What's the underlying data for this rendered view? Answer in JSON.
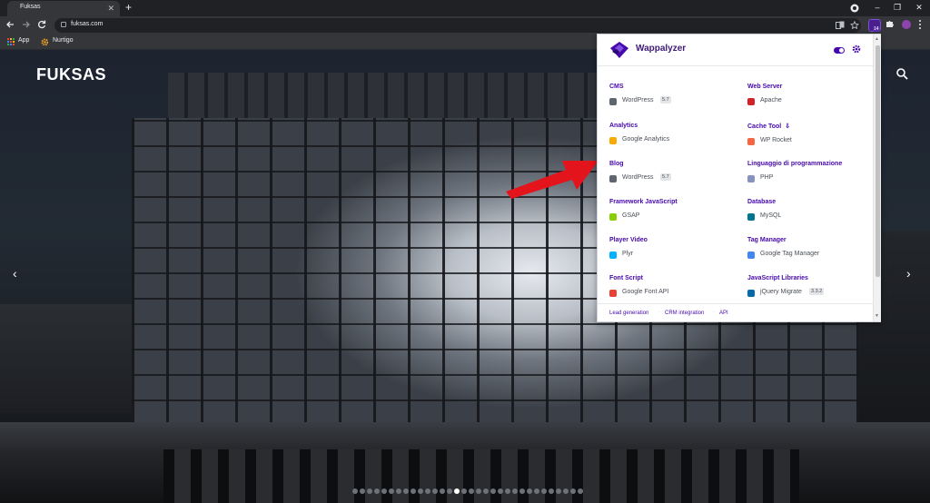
{
  "browser": {
    "tab_title": "Fuksas",
    "tab_close": "✕",
    "new_tab": "+",
    "window_controls": [
      "–",
      "❐",
      "✕"
    ],
    "url": "fuksas.com",
    "nav_icons": [
      "back-icon",
      "forward-icon",
      "reload-icon"
    ],
    "extension_badge": "14",
    "bookmarks": [
      {
        "label": "App",
        "icon": "apps-grid-icon"
      },
      {
        "label": "Nurtigo",
        "icon": "gear-orange-icon"
      }
    ]
  },
  "site": {
    "logo": "FUKSAS",
    "prev_arrow": "‹",
    "next_arrow": "›",
    "slide_count": 32,
    "active_slide": 14
  },
  "wappalyzer": {
    "title": "Wappalyzer",
    "toggle_on": true,
    "accent_color": "#4608ad",
    "categories_left": [
      {
        "name": "CMS",
        "techs": [
          {
            "name": "WordPress",
            "version": "5.7",
            "icon": "wordpress-icon",
            "color": "#5f6670"
          }
        ]
      },
      {
        "name": "Analytics",
        "techs": [
          {
            "name": "Google Analytics",
            "version": "",
            "icon": "google-analytics-icon",
            "color": "#f9ab00"
          }
        ]
      },
      {
        "name": "Blog",
        "techs": [
          {
            "name": "WordPress",
            "version": "5.7",
            "icon": "wordpress-icon",
            "color": "#5f6670"
          }
        ]
      },
      {
        "name": "Framework JavaScript",
        "techs": [
          {
            "name": "GSAP",
            "version": "",
            "icon": "gsap-icon",
            "color": "#88ce02"
          }
        ]
      },
      {
        "name": "Player Video",
        "techs": [
          {
            "name": "Plyr",
            "version": "",
            "icon": "plyr-icon",
            "color": "#00b3ff"
          }
        ]
      },
      {
        "name": "Font Script",
        "techs": [
          {
            "name": "Google Font API",
            "version": "",
            "icon": "google-font-icon",
            "color": "#e94235"
          }
        ]
      }
    ],
    "categories_right": [
      {
        "name": "Web Server",
        "pin": "",
        "techs": [
          {
            "name": "Apache",
            "version": "",
            "icon": "apache-feather-icon",
            "color": "#d22128"
          }
        ]
      },
      {
        "name": "Cache Tool",
        "pin": "⇩",
        "techs": [
          {
            "name": "WP Rocket",
            "version": "",
            "icon": "wp-rocket-icon",
            "color": "#f56640"
          }
        ]
      },
      {
        "name": "Linguaggio di programmazione",
        "pin": "",
        "techs": [
          {
            "name": "PHP",
            "version": "",
            "icon": "php-icon",
            "color": "#8892bf"
          }
        ]
      },
      {
        "name": "Database",
        "pin": "",
        "techs": [
          {
            "name": "MySQL",
            "version": "",
            "icon": "mysql-icon",
            "color": "#00758f"
          }
        ]
      },
      {
        "name": "Tag Manager",
        "pin": "",
        "techs": [
          {
            "name": "Google Tag Manager",
            "version": "",
            "icon": "google-tag-manager-icon",
            "color": "#4285f4"
          }
        ]
      },
      {
        "name": "JavaScript Libraries",
        "pin": "",
        "techs": [
          {
            "name": "jQuery Migrate",
            "version": "3.3.2",
            "icon": "jquery-icon",
            "color": "#0769ad"
          }
        ]
      }
    ],
    "footer_links": [
      "Lead generation",
      "CRM integration",
      "API"
    ]
  },
  "annotation": {
    "arrow_color": "#e3141b"
  }
}
